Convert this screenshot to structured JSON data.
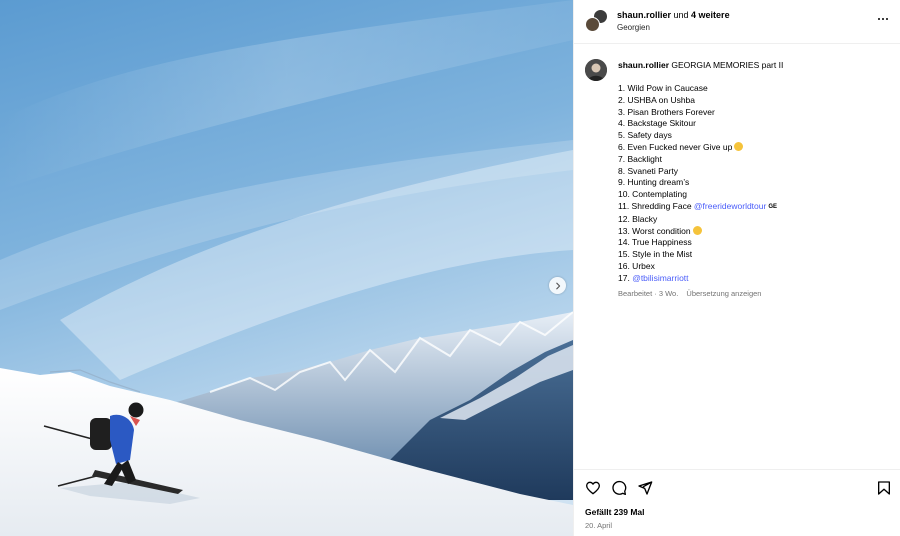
{
  "photo": {
    "alt_subject": "skier",
    "next_icon": "chevron-right-icon"
  },
  "header": {
    "username": "shaun.rollier",
    "collab_text": " und ",
    "collab_count": "4 weitere",
    "location": "Georgien",
    "more_icon": "more-horizontal-icon"
  },
  "caption": {
    "username": "shaun.rollier",
    "text": "GEORGIA MEMORIES part II",
    "items": [
      {
        "text": "1. Wild Pow in Caucase"
      },
      {
        "text": "2. USHBA on Ushba"
      },
      {
        "text": "3. Pisan Brothers Forever"
      },
      {
        "text": "4. Backstage Skitour"
      },
      {
        "text": "5. Safety days"
      },
      {
        "text": "6. Even Fucked never Give up",
        "emoji": "👊"
      },
      {
        "text": "7. Backlight"
      },
      {
        "text": "8. Svaneti Party"
      },
      {
        "text": "9. Hunting dream’s"
      },
      {
        "text": "10. Contemplating"
      },
      {
        "text": "11. Shredding Face ",
        "mention": "@freerideworldtour",
        "badge": "GE"
      },
      {
        "text": "12. Blacky"
      },
      {
        "text": "13. Worst condition",
        "emoji": "😓"
      },
      {
        "text": "14. True Happiness"
      },
      {
        "text": "15. Style in the Mist"
      },
      {
        "text": "16. Urbex"
      },
      {
        "text": "17. ",
        "mention": "@tbilisimarriott"
      }
    ],
    "edited": "Bearbeitet · 3 Wo.",
    "translate": "Übersetzung anzeigen"
  },
  "actions": {
    "like_icon": "heart-icon",
    "comment_icon": "comment-icon",
    "share_icon": "send-icon",
    "save_icon": "bookmark-icon",
    "likes": "Gefällt 239 Mal",
    "date": "20. April"
  },
  "colors": {
    "mention": "#4a5df9",
    "border": "#efefef",
    "muted": "#737373"
  }
}
